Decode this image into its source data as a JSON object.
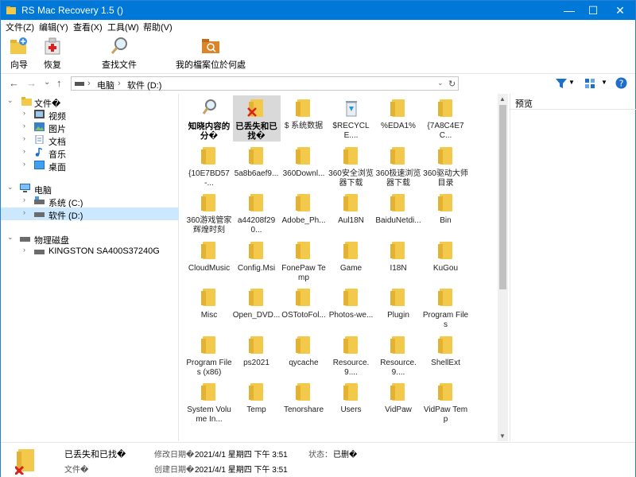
{
  "window": {
    "title": "RS Mac Recovery 1.5 ()",
    "minimize": "—",
    "maximize": "☐",
    "close": "✕"
  },
  "menu": [
    "文件(Z)",
    "编辑(Y)",
    "查看(X)",
    "工具(W)",
    "帮助(V)"
  ],
  "toolbar": {
    "wizard": "向导",
    "restore": "恢复",
    "find": "查找文件",
    "where_files": "我的檔案位於何處"
  },
  "nav": {
    "back": "←",
    "forward": "→",
    "dropdown": "⌄",
    "up": "↑",
    "path": [
      "电脑",
      "软件 (D:)"
    ],
    "sep": "›",
    "refresh": "↻"
  },
  "tree": {
    "files": "文件�",
    "video": "视频",
    "pictures": "图片",
    "documents": "文档",
    "music": "音乐",
    "desktop": "桌面",
    "computer": "电脑",
    "system": "系统 (C:)",
    "software": "软件 (D:)",
    "physical": "物理磁盘",
    "kingston": "KINGSTON SA400S37240G"
  },
  "items": [
    "知晓内容的分�",
    "已丢失和已找�",
    "$ 系统数据",
    "$RECYCLE....",
    "%EDA1%",
    "{7A8C4E7C...",
    "{10E7BD57-...",
    "5a8b6aef9...",
    "360Downl...",
    "360安全浏览器下载",
    "360极速浏览器下载",
    "360驱动大师目录",
    "360游戏管家辉煌时刻",
    "a44208f290...",
    "Adobe_Ph...",
    "Aul18N",
    "BaiduNetdi...",
    "Bin",
    "CloudMusic",
    "Config.Msi",
    "FonePaw Temp",
    "Game",
    "I18N",
    "KuGou",
    "Misc",
    "Open_DVD...",
    "OSTotoFol...",
    "Photos-we...",
    "Plugin",
    "Program Files",
    "Program Files (x86)",
    "ps2021",
    "qycache",
    "Resource.9....",
    "Resource.9....",
    "ShellExt",
    "System Volume In...",
    "Temp",
    "Tenorshare",
    "Users",
    "VidPaw",
    "VidPaw Temp"
  ],
  "preview": {
    "label": "预览"
  },
  "status": {
    "name": "已丢失和已找�",
    "type": "文件�",
    "modified_label": "修改日期�",
    "modified": "2021/4/1 星期四 下午 3:51",
    "created_label": "创建日期�",
    "created": "2021/4/1 星期四 下午 3:51",
    "state_label": "状态：",
    "state": "已删�"
  },
  "colors": {
    "titlebar": "#0078d7",
    "folder": "#f3c94b",
    "selection": "#cce8ff"
  }
}
